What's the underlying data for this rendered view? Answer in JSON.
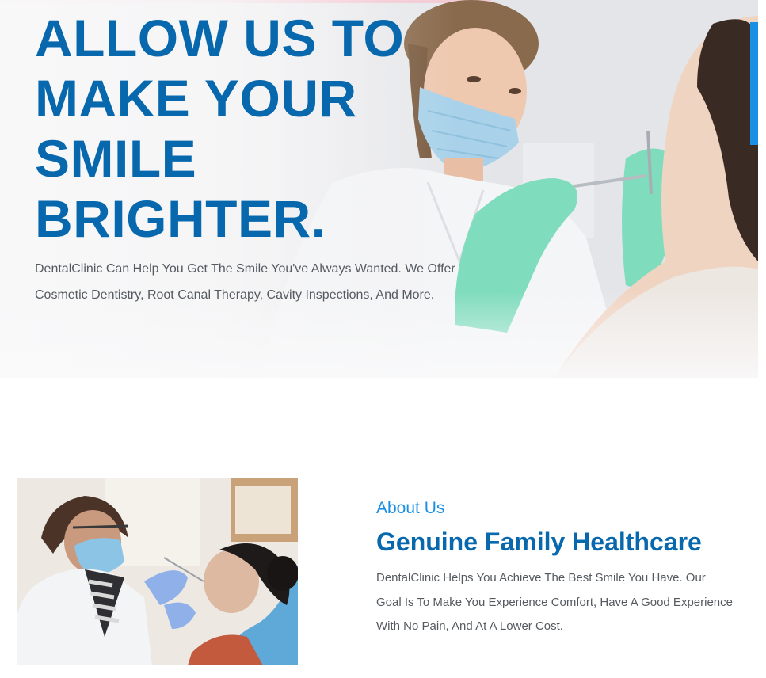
{
  "hero": {
    "title_lines": [
      "ALLOW US TO",
      "MAKE YOUR",
      "SMILE",
      "BRIGHTER."
    ],
    "subtitle": "DentalClinic Can Help You Get The Smile You've Always Wanted. We Offer Cosmetic Dentistry, Root Canal Therapy, Cavity Inspections, And More.",
    "image": "dentist-with-patient-photo"
  },
  "about": {
    "label": "About Us",
    "title": "Genuine Family Healthcare",
    "text": "DentalClinic Helps You Achieve The Best Smile You Have. Our Goal Is To Make You Experience Comfort, Have A Good Experience With No Pain, And At A Lower Cost.",
    "image": "dentist-examining-patient-photo"
  },
  "colors": {
    "heading": "#0868ad",
    "accent": "#1a8fe3",
    "body_text": "#555a60"
  }
}
